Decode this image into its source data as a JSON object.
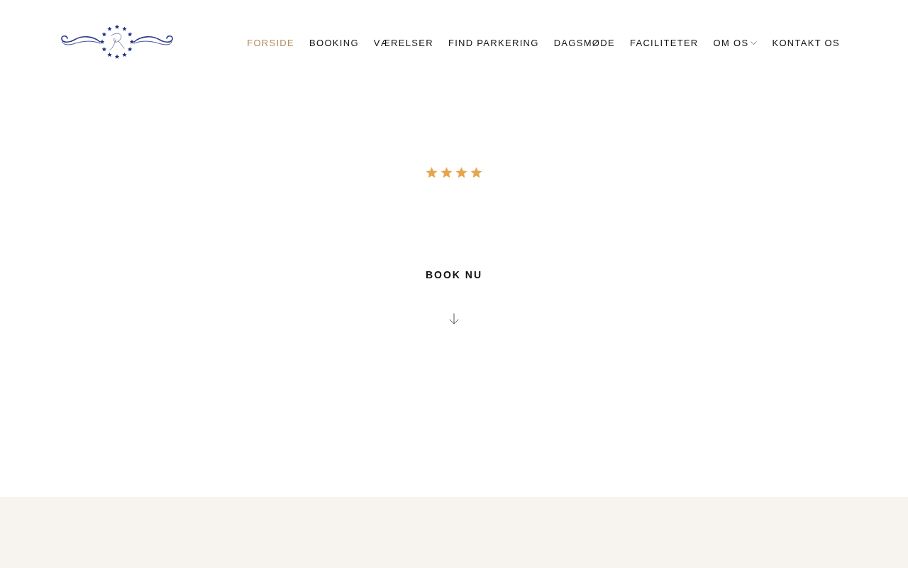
{
  "header": {
    "nav": {
      "items": [
        {
          "label": "FORSIDE",
          "selected": true,
          "kind": "link"
        },
        {
          "label": "BOOKING",
          "selected": false,
          "kind": "link"
        },
        {
          "label": "VÆRELSER",
          "selected": false,
          "kind": "link"
        },
        {
          "label": "FIND PARKERING",
          "selected": false,
          "kind": "link"
        },
        {
          "label": "DAGSMØDE",
          "selected": false,
          "kind": "link"
        },
        {
          "label": "FACILITETER",
          "selected": false,
          "kind": "link"
        },
        {
          "label": "OM OS",
          "selected": false,
          "kind": "dropdown"
        },
        {
          "label": "KONTAKT OS",
          "selected": false,
          "kind": "link"
        }
      ]
    }
  },
  "hero": {
    "stars": 4,
    "cta": {
      "label": "BOOK NU"
    }
  }
}
